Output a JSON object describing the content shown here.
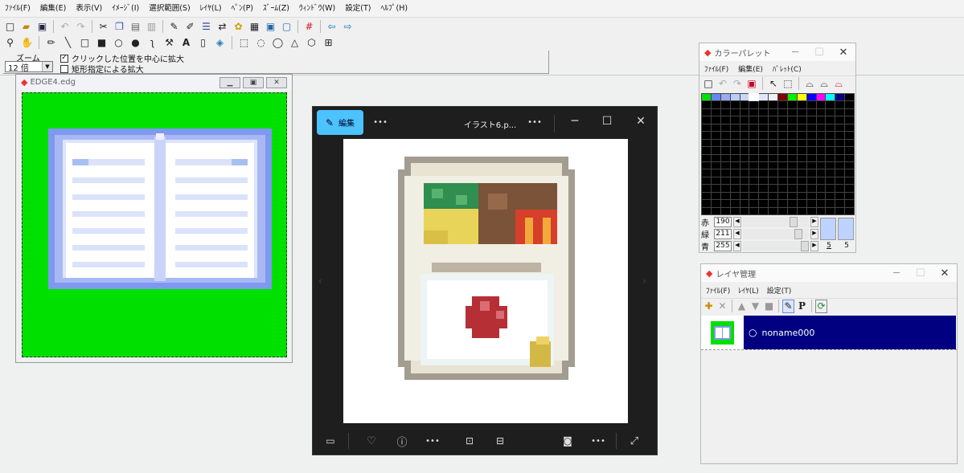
{
  "menu": [
    "ﾌｧｲﾙ(F)",
    "編集(E)",
    "表示(V)",
    "ｲﾒｰｼﾞ(I)",
    "選択範囲(S)",
    "ﾚｲﾔ(L)",
    "ﾍﾟﾝ(P)",
    "ｽﾞｰﾑ(Z)",
    "ｳｨﾝﾄﾞｳ(W)",
    "設定(T)",
    "ﾍﾙﾌﾟ(H)"
  ],
  "zoom": {
    "label": "ズーム",
    "value": "12 倍",
    "option1": "クリックした位置を中心に拡大",
    "option2": "矩形指定による拡大",
    "option1_checked": true,
    "option2_checked": false
  },
  "edge_window": {
    "title": "EDGE4.edg"
  },
  "viewer": {
    "edit_label": "編集",
    "title": "イラスト6.p...",
    "more": "•••"
  },
  "palette": {
    "title": "カラーパレット",
    "menu": [
      "ﾌｧｲﾙ(F)",
      "編集(E)",
      "ﾊﾟﾚｯﾄ(C)"
    ],
    "red_label": "赤",
    "red_value": "190",
    "green_label": "緑",
    "green_value": "211",
    "blue_label": "青",
    "blue_value": "255",
    "index_a": "5",
    "index_b": "5",
    "colors": [
      "#00e000",
      "#6688ee",
      "#99aaf0",
      "#bbccf6",
      "#c8d6fa",
      "#ffffff",
      "#dfe6fb",
      "#eef1fc",
      "#7f0000",
      "#00ee00",
      "#ffff00",
      "#0000ff",
      "#ff00ff",
      "#00ffff",
      "#000080"
    ]
  },
  "layers": {
    "title": "レイヤ管理",
    "menu": [
      "ﾌｧｲﾙ(F)",
      "ﾚｲﾔ(L)",
      "設定(T)"
    ],
    "layer_name": "noname000",
    "p_label": "P"
  }
}
